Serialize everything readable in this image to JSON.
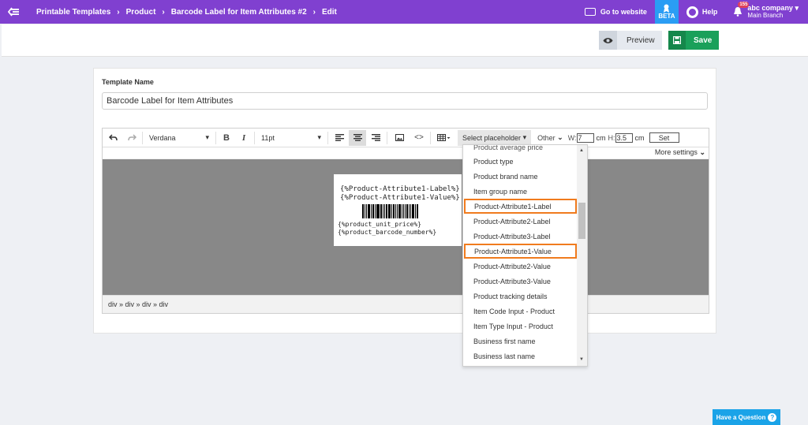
{
  "breadcrumb": [
    "Printable Templates",
    "Product",
    "Barcode Label for Item Attributes #2",
    "Edit"
  ],
  "topbar": {
    "go_to_website": "Go to website",
    "beta": "BETA",
    "help": "Help",
    "notification_count": "155",
    "company": "abc company",
    "branch": "Main Branch"
  },
  "actions": {
    "preview": "Preview",
    "save": "Save"
  },
  "form": {
    "template_name_label": "Template Name",
    "template_name_value": "Barcode Label for Item Attributes"
  },
  "toolbar": {
    "font": "Verdana",
    "bold": "B",
    "italic": "I",
    "size": "11pt",
    "code": "<>",
    "placeholder_select": "Select placeholder",
    "other": "Other",
    "w_label": "W:",
    "w_value": "7",
    "cm1": "cm",
    "h_label": "H:",
    "h_value": "3.5",
    "cm2": "cm",
    "set": "Set",
    "more_settings": "More settings"
  },
  "canvas": {
    "line1": "{%Product-Attribute1-Label%}",
    "line2": "{%Product-Attribute1-Value%}",
    "line3": "{%product_unit_price%}",
    "line4": "{%product_barcode_number%}"
  },
  "statusbar": {
    "path": "div » div » div » div"
  },
  "dropdown": {
    "partial_item": "Product average price",
    "items": [
      {
        "label": "Product type",
        "highlighted": false
      },
      {
        "label": "Product brand name",
        "highlighted": false
      },
      {
        "label": "Item group name",
        "highlighted": false
      },
      {
        "label": "Product-Attribute1-Label",
        "highlighted": true
      },
      {
        "label": "Product-Attribute2-Label",
        "highlighted": false
      },
      {
        "label": "Product-Attribute3-Label",
        "highlighted": false
      },
      {
        "label": "Product-Attribute1-Value",
        "highlighted": true
      },
      {
        "label": "Product-Attribute2-Value",
        "highlighted": false
      },
      {
        "label": "Product-Attribute3-Value",
        "highlighted": false
      },
      {
        "label": "Product tracking details",
        "highlighted": false
      },
      {
        "label": "Item Code Input - Product",
        "highlighted": false
      },
      {
        "label": "Item Type Input - Product",
        "highlighted": false
      },
      {
        "label": "Business first name",
        "highlighted": false
      },
      {
        "label": "Business last name",
        "highlighted": false
      }
    ]
  },
  "help_button": {
    "label": "Have a Question",
    "q": "?"
  },
  "colors": {
    "topbar": "#8040d0",
    "save": "#1aa05a",
    "highlight": "#f07b1e",
    "beta": "#2a9df4"
  },
  "icons": [
    "menu-icon",
    "website-icon",
    "beta-icon",
    "help-icon",
    "bell-icon",
    "eye-icon",
    "save-icon",
    "undo-icon",
    "redo-icon",
    "align-left-icon",
    "align-center-icon",
    "align-right-icon",
    "image-icon",
    "code-icon",
    "table-icon"
  ]
}
